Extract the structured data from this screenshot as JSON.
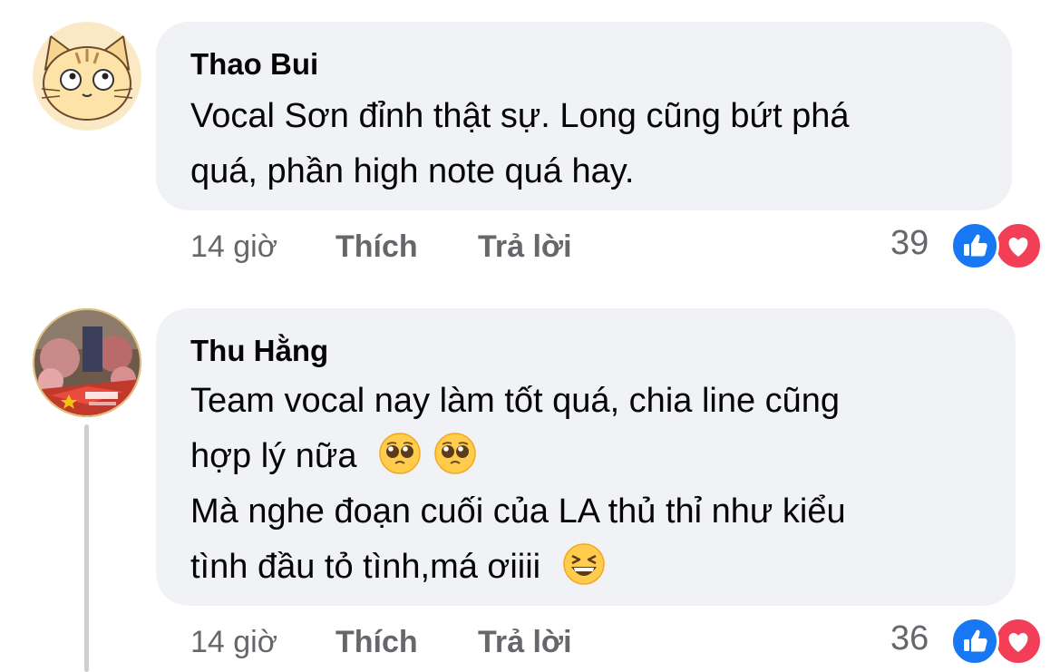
{
  "comments": [
    {
      "author": "Thao Bui",
      "lines": [
        "Vocal Sơn đỉnh thật sự. Long cũng bứt phá",
        "quá, phần high note quá hay."
      ],
      "time": "14 giờ",
      "like_label": "Thích",
      "reply_label": "Trả lời",
      "reaction_count": "39",
      "avatar_icon": "cat-face-avatar"
    },
    {
      "author": "Thu Hằng",
      "lines": [
        "Team vocal nay làm tốt quá, chia line cũng",
        "hợp lý nữa",
        "Mà nghe đoạn cuối của LA thủ thỉ như kiểu",
        "tình đầu tỏ tình,má ơiiii"
      ],
      "emojis": [
        "pleading-face",
        "pleading-face",
        "grinning-squinting-face"
      ],
      "time": "14 giờ",
      "like_label": "Thích",
      "reply_label": "Trả lời",
      "reaction_count": "36",
      "avatar_icon": "photo-avatar"
    }
  ],
  "colors": {
    "bubble": "#f0f2f5",
    "meta": "#65676b",
    "like": "#1877f2",
    "love": "#f33e58"
  }
}
